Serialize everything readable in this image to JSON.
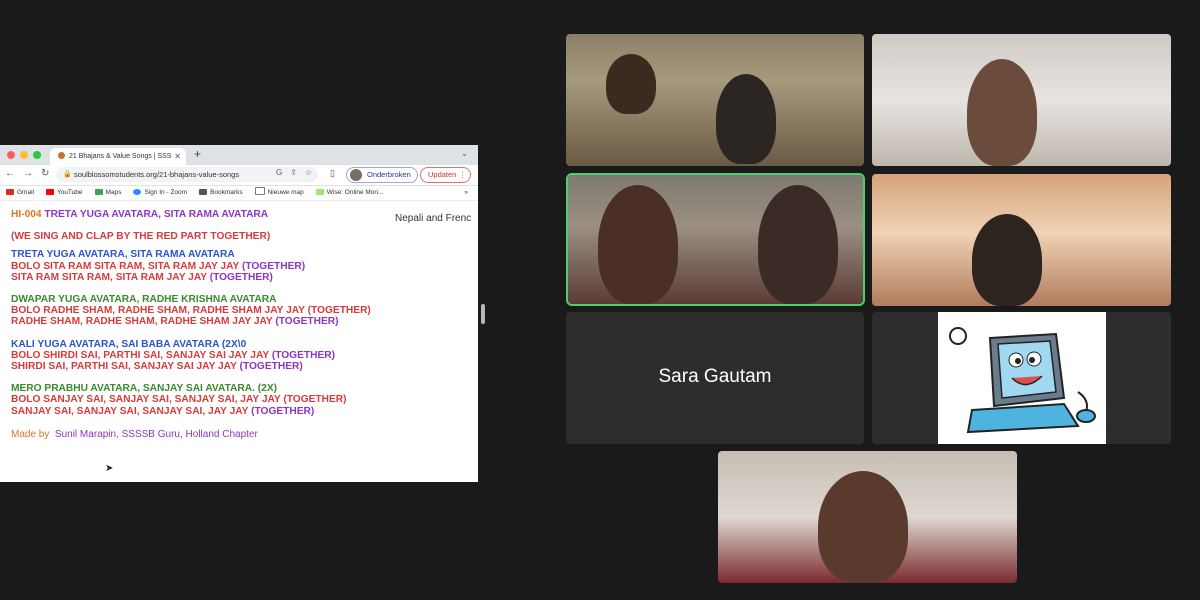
{
  "browser": {
    "tab_title": "21 Bhajans & Value Songs | SSS",
    "url": "soulblossomstudents.org/21-bhajans-value-songs",
    "profile_status": "Onderbroken",
    "update_label": "Updaten",
    "bookmarks": [
      {
        "label": "Gmail",
        "color": "#d93025"
      },
      {
        "label": "YouTube",
        "color": "#ff0000"
      },
      {
        "label": "Maps",
        "color": "#34a853"
      },
      {
        "label": "Sign In - Zoom",
        "color": "#2d8cff"
      },
      {
        "label": "Bookmarks",
        "color": "#555555"
      },
      {
        "label": "Nieuwe map",
        "color": "#777777"
      },
      {
        "label": "Wise: Online Mon...",
        "color": "#9fe870"
      }
    ]
  },
  "document": {
    "code": "HI-004",
    "title": "TRETA YUGA AVATARA, SITA RAMA AVATARA",
    "side_note": "Nepali and Frenc",
    "instruction": "(WE SING AND CLAP BY THE RED PART TOGETHER)",
    "stanza1": {
      "l1": "TRETA YUGA AVATARA, SITA RAMA AVATARA",
      "l2a": "BOLO SITA RAM SITA RAM, SITA RAM JAY JAY ",
      "l2b": "(TOGETHER)",
      "l3a": "SITA RAM SITA RAM, SITA RAM JAY JAY ",
      "l3b": "(TOGETHER)"
    },
    "stanza2": {
      "l1": "DWAPAR YUGA AVATARA, RADHE KRISHNA AVATARA",
      "l2": "BOLO RADHE SHAM, RADHE SHAM, RADHE SHAM JAY JAY (TOGETHER)",
      "l3a": "RADHE SHAM, RADHE SHAM, RADHE SHAM JAY JAY ",
      "l3b": "(TOGETHER)"
    },
    "stanza3": {
      "l1": "KALI YUGA AVATARA, SAI BABA AVATARA (2X\\0",
      "l2a": "BOLO SHIRDI SAI, PARTHI SAI, SANJAY SAI JAY JAY ",
      "l2b": "(TOGETHER)",
      "l3a": "SHIRDI SAI, PARTHI SAI, SANJAY SAI JAY JAY ",
      "l3b": "(TOGETHER)"
    },
    "stanza4": {
      "l1": "MERO PRABHU AVATARA, SANJAY SAI AVATARA. (2X)",
      "l2": "BOLO SANJAY SAI, SANJAY SAI, SANJAY SAI, JAY JAY (TOGETHER)",
      "l3a": "SANJAY SAI, SANJAY SAI, SANJAY SAI, JAY JAY ",
      "l3b": "(TOGETHER)"
    },
    "made_by_label": "Made by",
    "made_by_value": "Sunil Marapin, SSSSB Guru, Holland Chapter"
  },
  "participants": {
    "named_tile": "Sara Gautam"
  },
  "colors": {
    "active_speaker": "#4bd06a",
    "background": "#1a1a1a"
  }
}
